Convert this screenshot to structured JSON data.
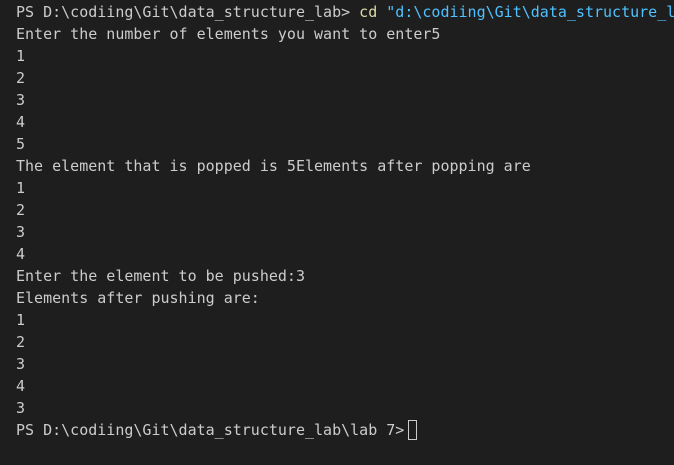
{
  "terminal": {
    "first_prompt": "PS D:\\codiing\\Git\\data_structure_lab> ",
    "first_command": "cd",
    "first_command_arg": " \"d:\\codiing\\Git\\data_structure_l",
    "output_lines": [
      "Enter the number of elements you want to enter5",
      "1",
      "2",
      "3",
      "4",
      "5",
      "The element that is popped is 5Elements after popping are",
      "1",
      "2",
      "3",
      "4",
      "Enter the element to be pushed:3",
      "Elements after pushing are:",
      "1",
      "2",
      "3",
      "4",
      "3"
    ],
    "final_prompt": "PS D:\\codiing\\Git\\data_structure_lab\\lab 7>"
  },
  "colors": {
    "background": "#1e1e1e",
    "text": "#cccccc",
    "command": "#dcdcaa",
    "string": "#4fc1ff"
  }
}
